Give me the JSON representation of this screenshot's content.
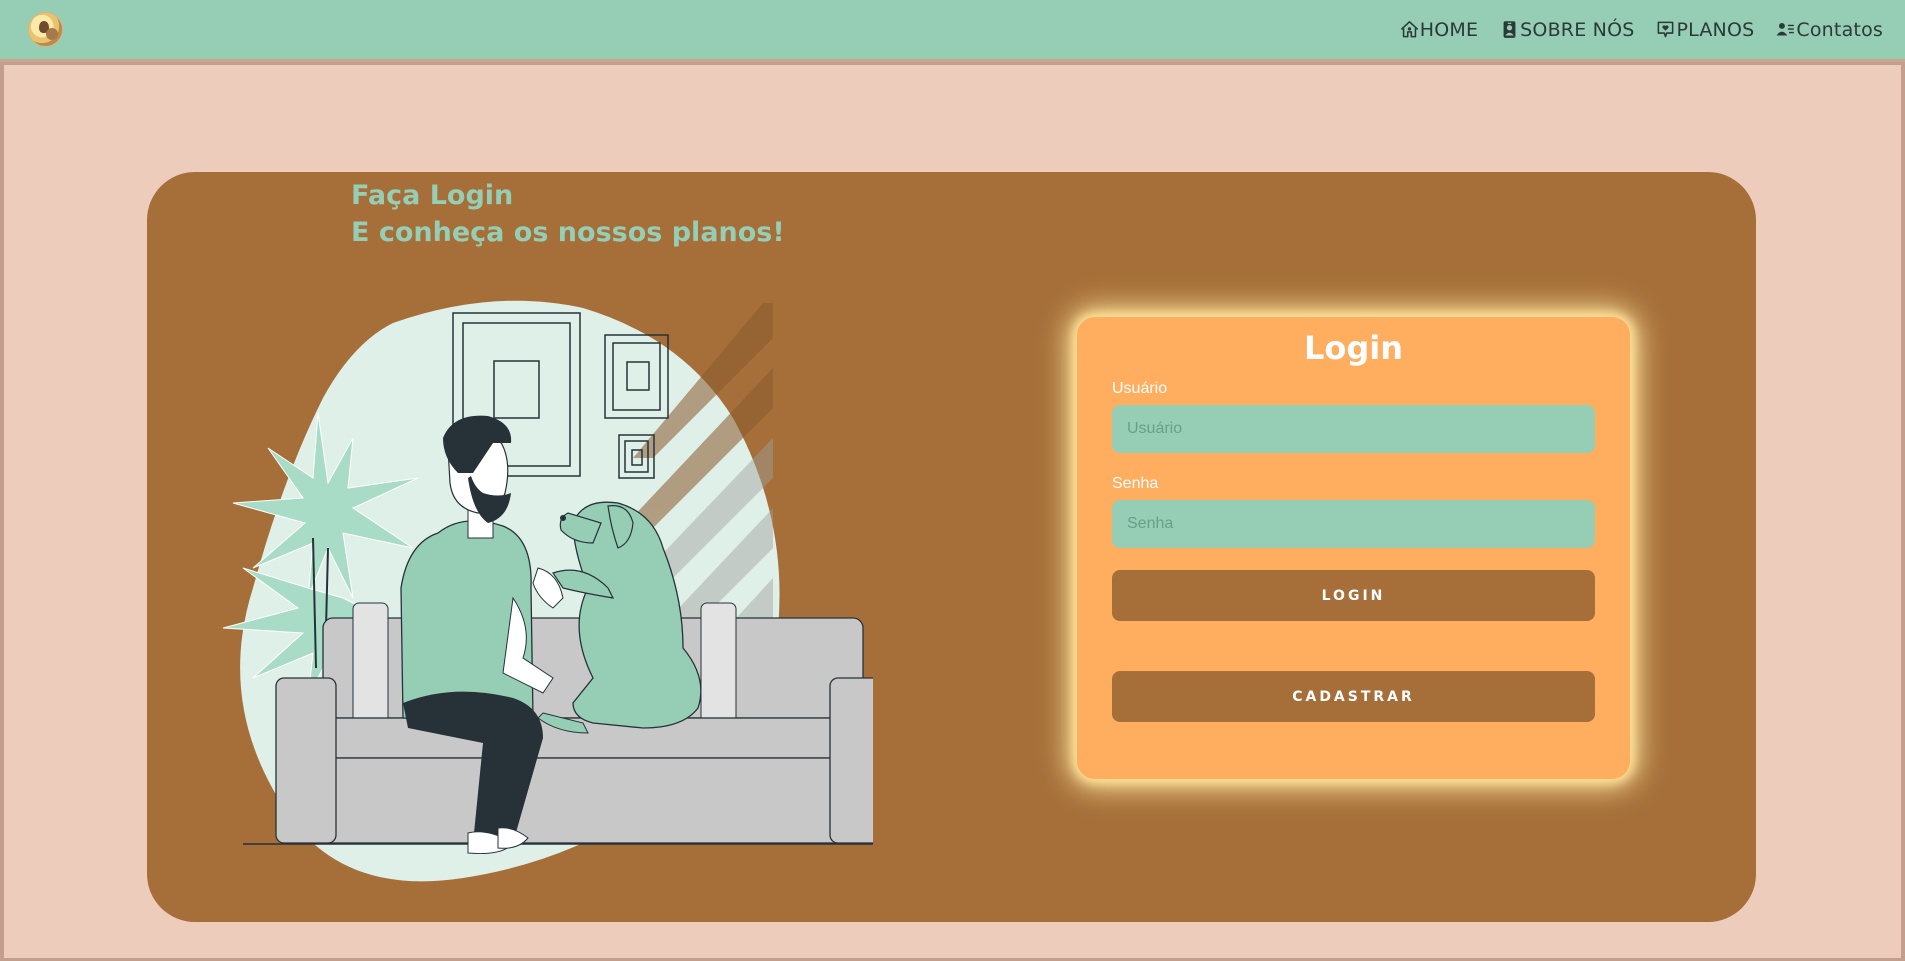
{
  "nav": {
    "logo_icon": "pet-logo-icon",
    "links": [
      {
        "label": "HOME",
        "icon": "home-icon"
      },
      {
        "label": "SOBRE NÓS",
        "icon": "person-badge-icon"
      },
      {
        "label": "PLANOS",
        "icon": "chat-heart-icon"
      },
      {
        "label": "Contatos",
        "icon": "person-lines-icon"
      }
    ]
  },
  "hero": {
    "heading_line1": "Faça Login",
    "heading_line2": "E conheça os nossos planos!",
    "illustration": "man-with-dog-on-sofa-illustration"
  },
  "login": {
    "title": "Login",
    "user_label": "Usuário",
    "user_placeholder": "Usuário",
    "user_value": "",
    "password_label": "Senha",
    "password_placeholder": "Senha",
    "password_value": "",
    "login_button": "LOGIN",
    "register_button": "CADASTRAR"
  },
  "colors": {
    "navbar": "#96cdb5",
    "page_bg": "#eeccbc",
    "card_bg": "#a66f39",
    "login_box": "#ffad5e",
    "input_bg": "#96cdb5",
    "heading": "#96cdb5"
  }
}
